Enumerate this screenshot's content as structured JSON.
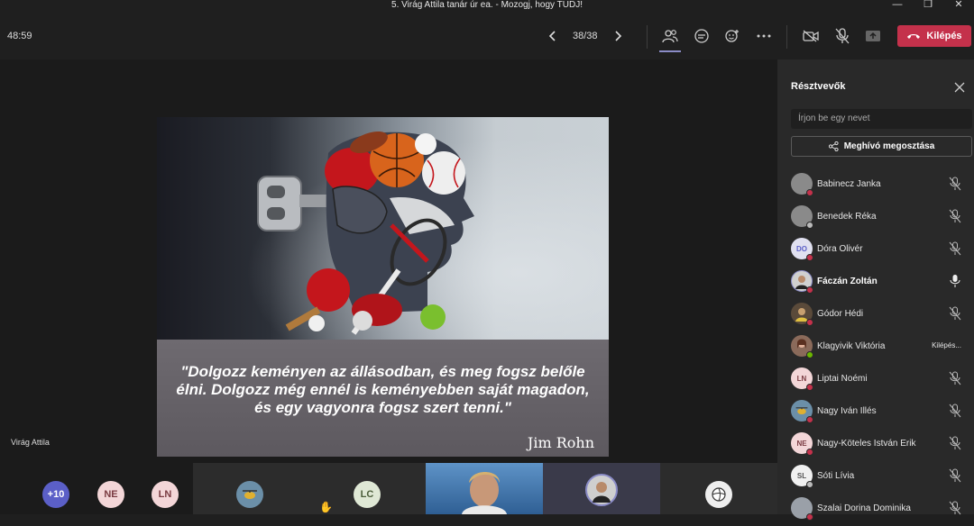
{
  "window": {
    "title": "5. Virág Attila tanár úr ea. - Mozogj, hogy TUDJ!",
    "controls": [
      "—",
      "❐",
      "✕"
    ]
  },
  "toolbar": {
    "timer": "48:59",
    "slide_counter": "38/38",
    "leave_label": "Kilépés",
    "colors": {
      "leave": "#c4314b",
      "accent": "#8b8cc7"
    }
  },
  "slide": {
    "quote": "\"Dolgozz keményen az állásodban, és meg fogsz belőle élni. Dolgozz még ennél is keményebben saját magadon, és egy vagyonra fogsz szert tenni.\"",
    "author": "Jim Rohn"
  },
  "stage": {
    "presenter_name": "Virág Attila"
  },
  "bottom_strip": {
    "overflow_count": "+10",
    "avatars": [
      "NE",
      "LN",
      "LC"
    ]
  },
  "panel": {
    "title": "Résztvevők",
    "search_placeholder": "Írjon be egy nevet",
    "invite_label": "Meghívó megosztása",
    "participants": [
      {
        "name": "Babinecz Janka",
        "initials": "",
        "status": "busy",
        "mic": "muted"
      },
      {
        "name": "Benedek Réka",
        "initials": "",
        "status": "away",
        "mic": "muted"
      },
      {
        "name": "Dóra Olivér",
        "initials": "DO",
        "status": "busy",
        "mic": "muted"
      },
      {
        "name": "Fáczán Zoltán",
        "initials": "",
        "status": "busy",
        "mic": "on"
      },
      {
        "name": "Gódor Hédi",
        "initials": "",
        "status": "busy",
        "mic": "muted"
      },
      {
        "name": "Klagyivik Viktória",
        "initials": "",
        "status": "available",
        "mic": "leaving",
        "extra": "Kilépés..."
      },
      {
        "name": "Liptai Noémi",
        "initials": "LN",
        "status": "busy",
        "mic": "muted"
      },
      {
        "name": "Nagy Iván Illés",
        "initials": "",
        "status": "busy",
        "mic": "muted"
      },
      {
        "name": "Nagy-Köteles István Erik",
        "initials": "NE",
        "status": "busy",
        "mic": "muted"
      },
      {
        "name": "Sóti Lívia",
        "initials": "SL",
        "status": "away",
        "mic": "muted"
      },
      {
        "name": "Szalai Dorina Dominika",
        "initials": "",
        "status": "busy",
        "mic": "muted"
      }
    ]
  }
}
